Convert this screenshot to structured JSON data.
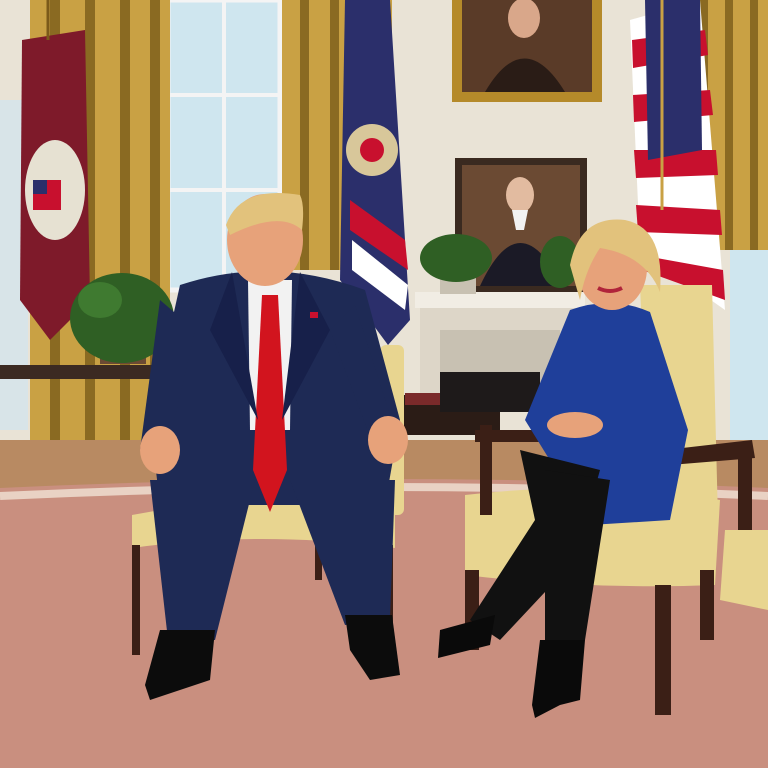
{
  "scene": {
    "kind": "photo-illustration",
    "colors": {
      "wall": "#e9e3d6",
      "curtain": "#c9a144",
      "curtain_shadow": "#8a6a22",
      "window": "#cfe6ef",
      "carpet": "#c98f7f",
      "carpet_dark": "#a8705f",
      "floor": "#b88a62",
      "chair_upholstery": "#e8d590",
      "chair_wood": "#3b1f16",
      "suit_navy": "#1e2a55",
      "tie_red": "#d2141e",
      "jacket_blue": "#1f3f9a",
      "pants_black": "#111111",
      "skin": "#e7a27a",
      "hair_blond": "#e2c27c",
      "flag_red": "#c8102e",
      "flag_blue": "#2b2f6b",
      "frame_gold": "#b58a2a",
      "plant_green": "#2f5f24"
    }
  }
}
